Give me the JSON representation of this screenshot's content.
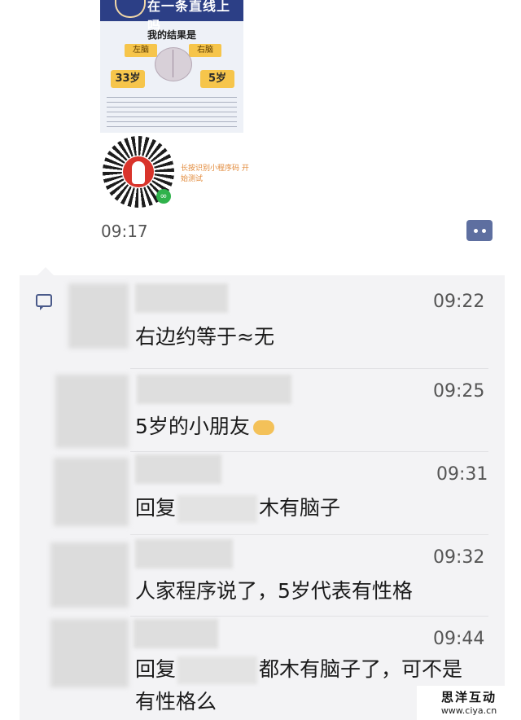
{
  "shared_poster": {
    "banner": "在一条直线上吗",
    "result_title": "我的结果是",
    "left_label": "左脑",
    "right_label": "右脑",
    "left_age": "33岁",
    "right_age": "5岁"
  },
  "mini_program": {
    "caption": "长按识别小程序码 开始测试"
  },
  "post": {
    "time": "09:17"
  },
  "comments": [
    {
      "time": "09:22",
      "text": "右边约等于≈无"
    },
    {
      "time": "09:25",
      "text": "5岁的小朋友"
    },
    {
      "time": "09:31",
      "prefix": "回复",
      "text": "木有脑子"
    },
    {
      "time": "09:32",
      "text": "人家程序说了，5岁代表有性格"
    },
    {
      "time": "09:44",
      "prefix": "回复",
      "text": "都木有脑子了，可不是有性格么"
    }
  ],
  "watermark": {
    "title": "思洋互动",
    "url": "www.ciya.cn"
  },
  "colors": {
    "accent": "#5e6fa0",
    "comment_bg": "#f3f3f5",
    "poster_banner": "#2c3f86",
    "badge_yellow": "#f6c54b"
  }
}
